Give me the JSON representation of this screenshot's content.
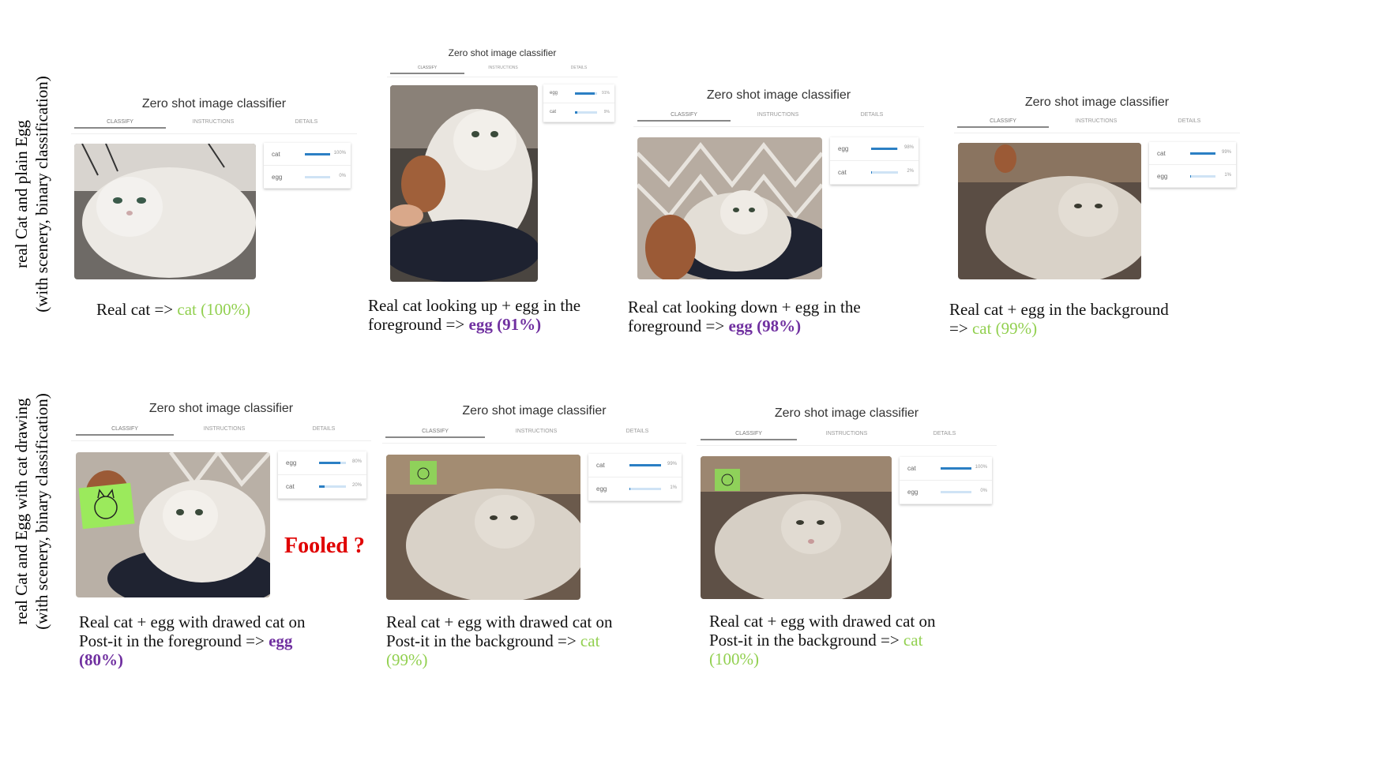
{
  "row_labels": {
    "top_line1": "real Cat and plain Egg",
    "top_line2": "(with scenery, binary classification)",
    "bottom_line1": "real Cat and Egg with cat drawing",
    "bottom_line2": "(with scenery, binary classification)"
  },
  "app_title": "Zero shot image classifier",
  "tabs": {
    "classify": "CLASSIFY",
    "instructions": "INSTRUCTIONS",
    "details": "DETAILS"
  },
  "fooled_label": "Fooled ?",
  "colors": {
    "cat_result": "#92d050",
    "egg_result": "#7030a0",
    "bar": "#2b7fc4",
    "fooled": "#e00000"
  },
  "panels": [
    {
      "results": [
        {
          "label": "cat",
          "percent": "100%",
          "value": 1.0
        },
        {
          "label": "egg",
          "percent": "0%",
          "value": 0.0
        }
      ],
      "caption_prefix": "Real cat => ",
      "caption_result": "cat (100%)",
      "result_class": "cat"
    },
    {
      "results": [
        {
          "label": "egg",
          "percent": "91%",
          "value": 0.91
        },
        {
          "label": "cat",
          "percent": "9%",
          "value": 0.09
        }
      ],
      "caption_prefix": "Real cat looking up + egg in the foreground => ",
      "caption_result": "egg (91%)",
      "result_class": "egg"
    },
    {
      "results": [
        {
          "label": "egg",
          "percent": "98%",
          "value": 0.98
        },
        {
          "label": "cat",
          "percent": "2%",
          "value": 0.02
        }
      ],
      "caption_prefix": "Real cat looking down + egg in the foreground => ",
      "caption_result": "egg (98%)",
      "result_class": "egg"
    },
    {
      "results": [
        {
          "label": "cat",
          "percent": "99%",
          "value": 0.99
        },
        {
          "label": "egg",
          "percent": "1%",
          "value": 0.01
        }
      ],
      "caption_prefix": "Real cat + egg in the background => ",
      "caption_result": "cat (99%)",
      "result_class": "cat"
    },
    {
      "results": [
        {
          "label": "egg",
          "percent": "80%",
          "value": 0.8
        },
        {
          "label": "cat",
          "percent": "20%",
          "value": 0.2
        }
      ],
      "caption_prefix": "Real cat + egg with drawed cat on Post-it in the foreground => ",
      "caption_result": "egg (80%)",
      "result_class": "egg"
    },
    {
      "results": [
        {
          "label": "cat",
          "percent": "99%",
          "value": 0.99
        },
        {
          "label": "egg",
          "percent": "1%",
          "value": 0.01
        }
      ],
      "caption_prefix": "Real cat + egg with drawed cat on Post-it in the background => ",
      "caption_result": "cat (99%)",
      "result_class": "cat"
    },
    {
      "results": [
        {
          "label": "cat",
          "percent": "100%",
          "value": 1.0
        },
        {
          "label": "egg",
          "percent": "0%",
          "value": 0.0
        }
      ],
      "caption_prefix": "Real cat + egg with drawed cat on Post-it in the background => ",
      "caption_result": "cat (100%)",
      "result_class": "cat"
    }
  ]
}
